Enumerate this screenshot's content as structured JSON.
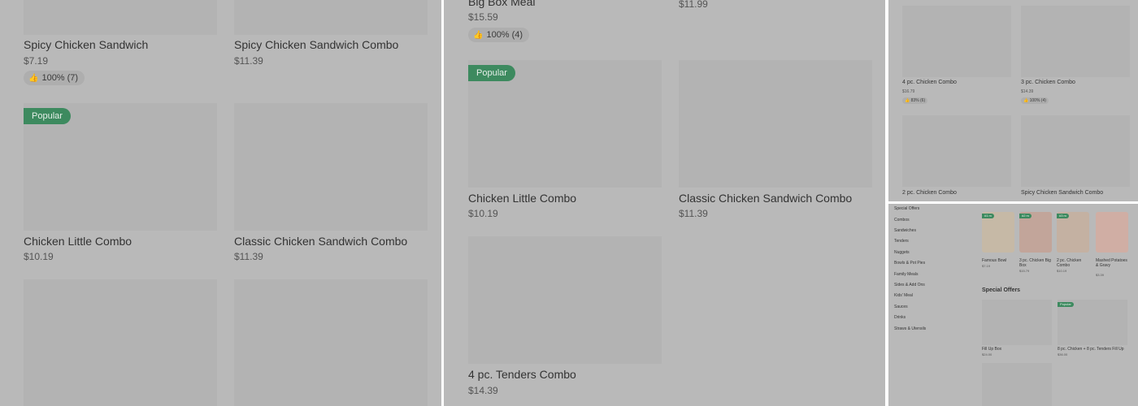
{
  "panel1": {
    "items": [
      {
        "name": "Spicy Chicken Sandwich",
        "price": "$7.19",
        "rating": "100% (7)"
      },
      {
        "name": "Spicy Chicken Sandwich Combo",
        "price": "$11.39"
      },
      {
        "name": "Chicken Little Combo",
        "price": "$10.19",
        "badge": "Popular"
      },
      {
        "name": "Classic Chicken Sandwich Combo",
        "price": "$11.39"
      }
    ]
  },
  "panel2": {
    "items": [
      {
        "name": "Big Box Meal",
        "price": "$15.59",
        "rating": "100% (4)"
      },
      {
        "price": "$11.99"
      },
      {
        "name": "Chicken Little Combo",
        "price": "$10.19",
        "badge": "Popular"
      },
      {
        "name": "Classic Chicken Sandwich Combo",
        "price": "$11.39"
      },
      {
        "name": "4 pc. Tenders Combo",
        "price": "$14.39"
      }
    ]
  },
  "panel3": {
    "items": [
      {
        "name": "4 pc. Chicken Combo",
        "price": "$16.79",
        "rating": "83% (6)"
      },
      {
        "name": "3 pc. Chicken Combo",
        "price": "$14.39",
        "rating": "100% (4)"
      },
      {
        "name": "2 pc. Chicken Combo"
      },
      {
        "name": "Spicy Chicken Sandwich Combo"
      }
    ]
  },
  "panel4": {
    "nav": [
      "Special Offers",
      "Combos",
      "Sandwiches",
      "Tenders",
      "Nuggets",
      "Bowls & Pot Pies",
      "Family Meals",
      "Sides & Add Ons",
      "Kids' Meal",
      "Sauces",
      "Drinks",
      "Straws & Utensils"
    ],
    "top_items": [
      {
        "name": "Famous Bowl",
        "price": "$7.19",
        "badge": "#1 m"
      },
      {
        "name": "3 pc. Chicken Big Box",
        "price": "$15.79",
        "badge": "#2 m"
      },
      {
        "name": "2 pc. Chicken Combo",
        "price": "$10.19",
        "badge": "#3 m"
      },
      {
        "name": "Mashed Potatoes & Gravy",
        "price": "$3.39"
      }
    ],
    "section_title": "Special Offers",
    "offers": [
      {
        "name": "Fill Up Box",
        "price": "$24.00"
      },
      {
        "name": "8 pc. Chicken + 8 pc. Tenders Fill Up",
        "price": "$36.00",
        "badge": "Popular"
      }
    ]
  },
  "icons": {
    "rating": "thumbs-up-icon"
  }
}
